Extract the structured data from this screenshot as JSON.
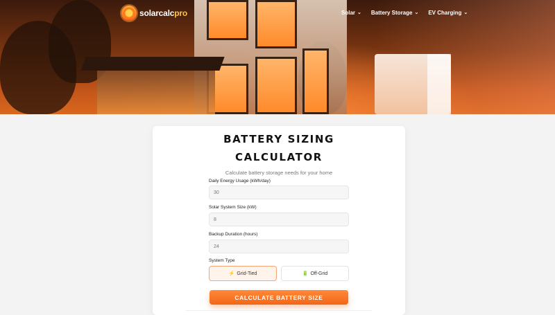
{
  "brand": {
    "logo_text_main": "solarcalc",
    "logo_text_accent": "pro"
  },
  "nav": {
    "items": [
      {
        "label": "Solar"
      },
      {
        "label": "Battery Storage"
      },
      {
        "label": "EV Charging"
      }
    ]
  },
  "calculator": {
    "title_line1": "BATTERY SIZING",
    "title_line2": "CALCULATOR",
    "subtitle": "Calculate battery storage needs for your home",
    "fields": [
      {
        "label": "Daily Energy Usage (kWh/day)",
        "placeholder": "30"
      },
      {
        "label": "Solar System Size (kW)",
        "placeholder": "8"
      },
      {
        "label": "Backup Duration (hours)",
        "placeholder": "24"
      }
    ],
    "system_type_label": "System Type",
    "system_types": [
      {
        "icon": "⚡",
        "label": "Grid-Tied",
        "selected": true
      },
      {
        "icon": "🔋",
        "label": "Off-Grid",
        "selected": false
      }
    ],
    "submit_label": "CALCULATE BATTERY SIZE"
  },
  "colors": {
    "accent": "#f26616",
    "accent_light": "#fff4ec"
  }
}
